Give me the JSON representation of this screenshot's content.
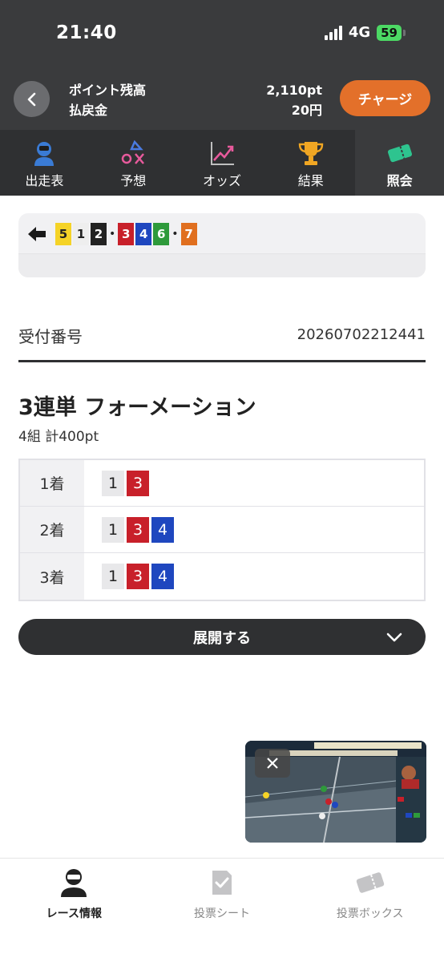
{
  "status_bar": {
    "time": "21:40",
    "network": "4G",
    "battery": "59"
  },
  "header": {
    "points_label": "ポイント残高",
    "refund_label": "払戻金",
    "points_value": "2,110pt",
    "refund_value": "20円",
    "charge_label": "チャージ"
  },
  "tabs": [
    {
      "label": "出走表",
      "icon": "racer-icon"
    },
    {
      "label": "予想",
      "icon": "prediction-icon"
    },
    {
      "label": "オッズ",
      "icon": "odds-chart-icon"
    },
    {
      "label": "結果",
      "icon": "trophy-icon"
    },
    {
      "label": "照会",
      "icon": "ticket-icon",
      "active": true
    }
  ],
  "bet_line": {
    "groups": [
      [
        {
          "n": "5",
          "bg": "#f5d327",
          "fg": "#222"
        },
        {
          "n": "1",
          "bg": "#eeeeee",
          "fg": "#222"
        },
        {
          "n": "2",
          "bg": "#222222",
          "fg": "#ffffff"
        }
      ],
      [
        {
          "n": "3",
          "bg": "#c8202a",
          "fg": "#ffffff"
        },
        {
          "n": "4",
          "bg": "#1f47bf",
          "fg": "#ffffff"
        },
        {
          "n": "6",
          "bg": "#2e9a3b",
          "fg": "#ffffff"
        }
      ],
      [
        {
          "n": "7",
          "bg": "#e06f1f",
          "fg": "#ffffff"
        }
      ]
    ]
  },
  "receipt": {
    "label": "受付番号",
    "value": "20260702212441"
  },
  "bet": {
    "title": "3連単 フォーメーション",
    "subtitle": "4組 計400pt",
    "rows": [
      {
        "place": "1着",
        "nums": [
          {
            "n": "1",
            "bg": "#e8e8ea",
            "fg": "#222"
          },
          {
            "n": "3",
            "bg": "#c8202a",
            "fg": "#ffffff"
          }
        ]
      },
      {
        "place": "2着",
        "nums": [
          {
            "n": "1",
            "bg": "#e8e8ea",
            "fg": "#222"
          },
          {
            "n": "3",
            "bg": "#c8202a",
            "fg": "#ffffff"
          },
          {
            "n": "4",
            "bg": "#1f47bf",
            "fg": "#ffffff"
          }
        ]
      },
      {
        "place": "3着",
        "nums": [
          {
            "n": "1",
            "bg": "#e8e8ea",
            "fg": "#222"
          },
          {
            "n": "3",
            "bg": "#c8202a",
            "fg": "#ffffff"
          },
          {
            "n": "4",
            "bg": "#1f47bf",
            "fg": "#ffffff"
          }
        ]
      }
    ]
  },
  "expand_label": "展開する",
  "bottom_nav": [
    {
      "label": "レース情報",
      "icon": "racer-icon",
      "active": true
    },
    {
      "label": "投票シート",
      "icon": "check-sheet-icon",
      "active": false
    },
    {
      "label": "投票ボックス",
      "icon": "ticket-icon",
      "active": false
    }
  ]
}
